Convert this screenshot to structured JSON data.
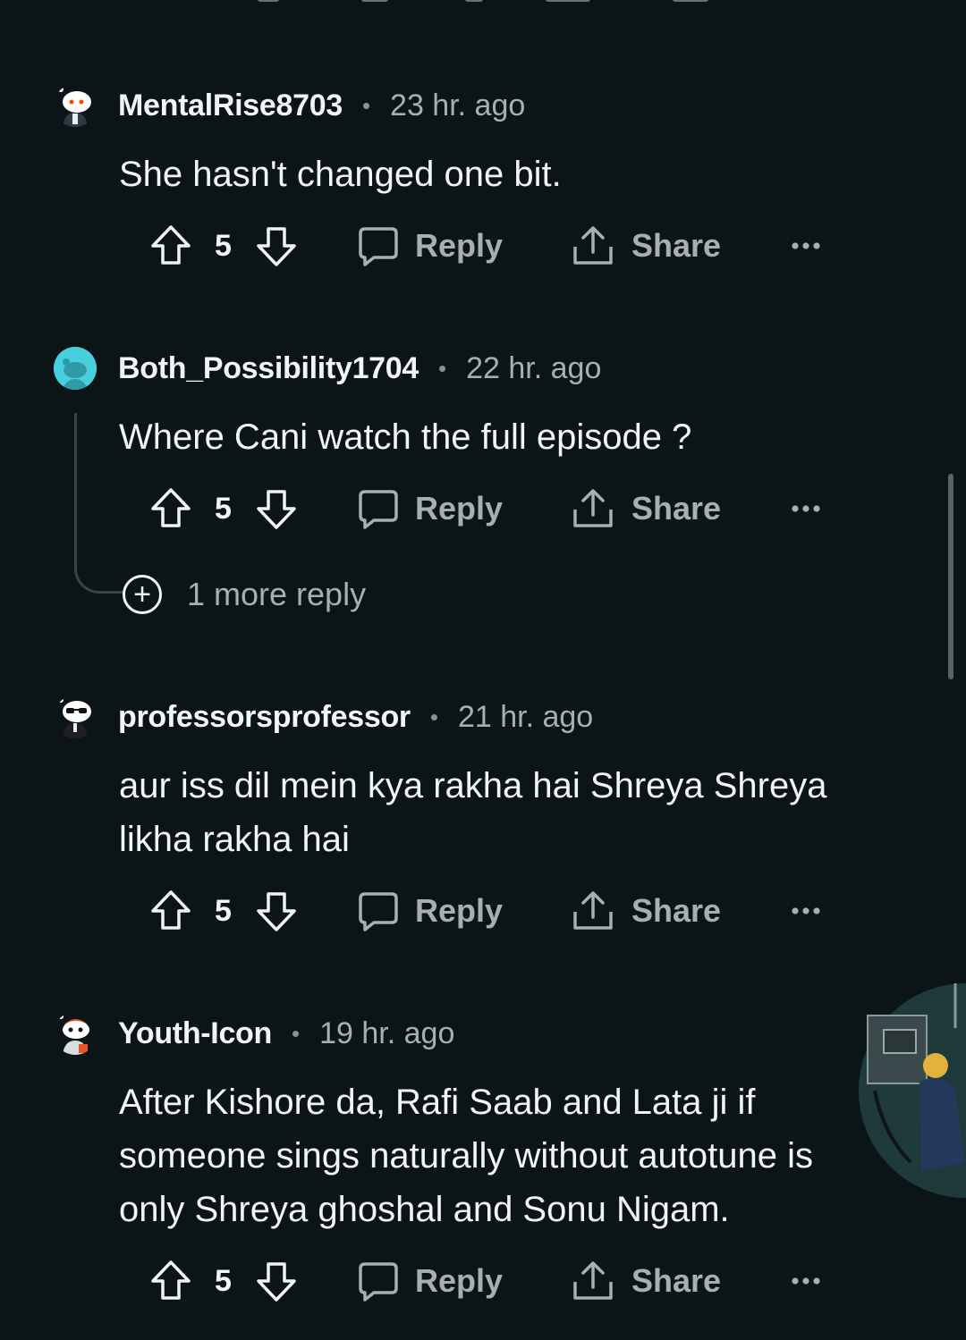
{
  "comments": [
    {
      "username": "MentalRise8703",
      "time": "23 hr. ago",
      "body": "She hasn't changed one bit.",
      "score": "5",
      "reply_label": "Reply",
      "share_label": "Share"
    },
    {
      "username": "Both_Possibility1704",
      "time": "22 hr. ago",
      "body": "Where Cani watch the full episode ?",
      "score": "5",
      "reply_label": "Reply",
      "share_label": "Share",
      "more_replies": "1 more reply"
    },
    {
      "username": "professorsprofessor",
      "time": "21 hr. ago",
      "body": "aur iss dil mein kya rakha hai Shreya Shreya likha rakha hai",
      "score": "5",
      "reply_label": "Reply",
      "share_label": "Share"
    },
    {
      "username": "Youth-Icon",
      "time": "19 hr. ago",
      "body": "After Kishore da, Rafi Saab and Lata ji if someone sings naturally without autotune is only Shreya ghoshal and Sonu Nigam.",
      "score": "5",
      "reply_label": "Reply",
      "share_label": "Share"
    }
  ],
  "icons": {
    "upvote": "arrow-up-icon",
    "downvote": "arrow-down-icon",
    "reply": "speech-bubble-icon",
    "share": "share-upload-icon",
    "more": "ellipsis-icon",
    "expand": "plus-circle-icon"
  },
  "colors": {
    "background": "#0b1416",
    "text": "#f2f4f5",
    "muted": "#a8aeb2",
    "thread_line": "#3a4246"
  }
}
